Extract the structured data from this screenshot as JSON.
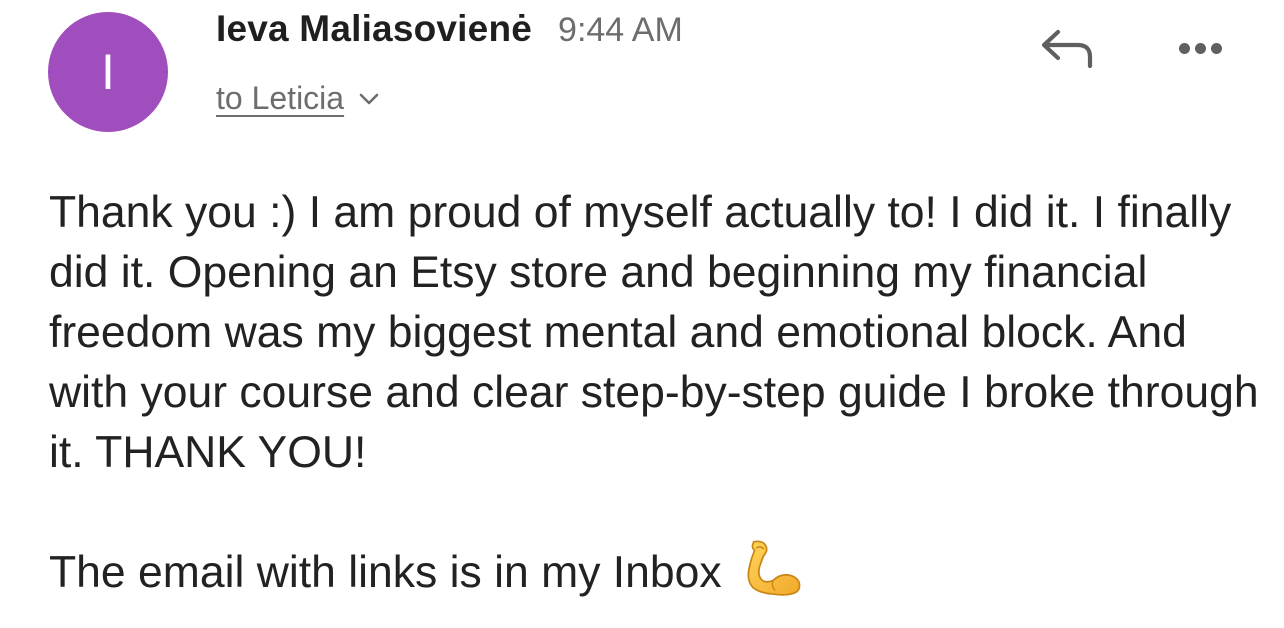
{
  "header": {
    "avatar_letter": "I",
    "avatar_color": "#a04dbd",
    "sender_name": "Ieva Maliasovienė",
    "time": "9:44 AM",
    "recipient": "to Leticia",
    "recipient_chevron_icon": "chevron-down-icon",
    "reply_icon": "reply-icon",
    "more_icon": "more-horizontal-icon"
  },
  "message": {
    "paragraph": "Thank you :) I am proud of myself actually to! I did it. I finally did it. Opening an Etsy store and beginning my financial freedom was my biggest mental and emotional block. And with your course and clear step-by-step guide I broke through it. THANK YOU!",
    "closing": "The email with links is in my Inbox",
    "closing_emoji_icon": "flexed-biceps-icon"
  }
}
